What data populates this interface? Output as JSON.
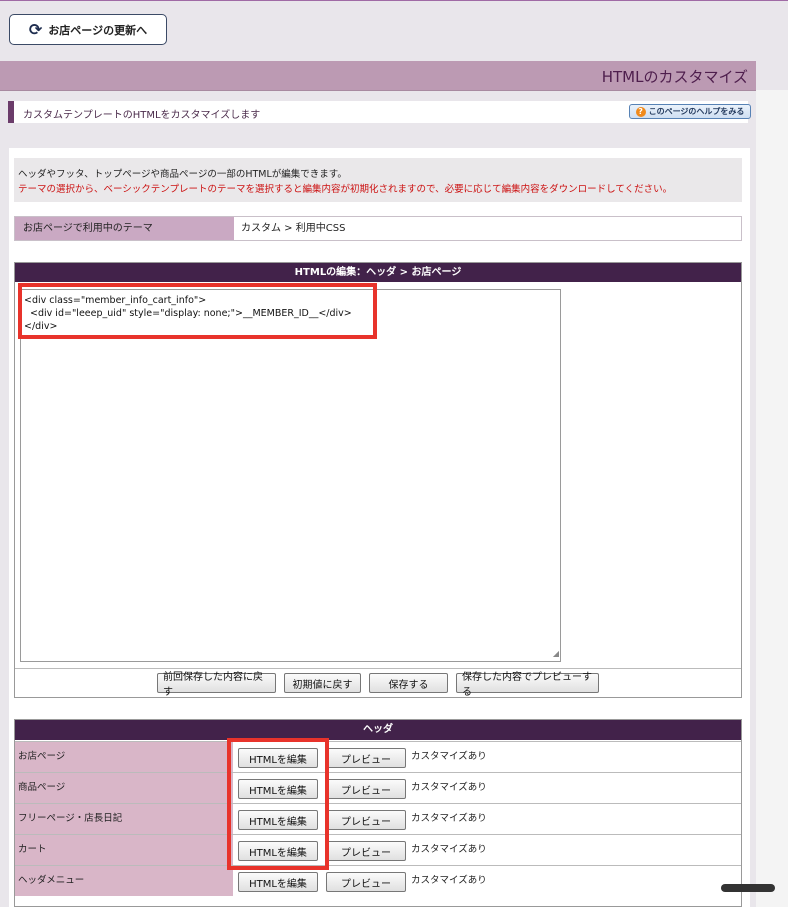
{
  "top_button": {
    "label": "お店ページの更新へ",
    "icon": "refresh-icon"
  },
  "page_title": "HTMLのカスタマイズ",
  "subheader": {
    "text": "カスタムテンプレートのHTMLをカスタマイズします",
    "help_label": "このページのヘルプをみる",
    "help_icon": "question-icon"
  },
  "info": {
    "line1": "ヘッダやフッタ、トップページや商品ページの一部のHTMLが編集できます。",
    "line2": "テーマの選択から、ベーシックテンプレートのテーマを選択すると編集内容が初期化されますので、必要に応じて編集内容をダウンロードしてください。"
  },
  "theme": {
    "label": "お店ページで利用中のテーマ",
    "value": "カスタム > 利用中CSS"
  },
  "editor": {
    "heading": "HTMLの編集：ヘッダ > お店ページ",
    "code_lines": [
      "<div class=\"member_info_cart_info\">",
      "  <div id=\"leeep_uid\" style=\"display: none;\">__MEMBER_ID__</div>",
      "</div>"
    ],
    "buttons": [
      "前回保存した内容に戻す",
      "初期値に戻す",
      "保存する",
      "保存した内容でプレビューする"
    ]
  },
  "header_section": {
    "heading": "ヘッダ",
    "edit_label": "HTMLを編集",
    "preview_label": "プレビュー",
    "rows": [
      {
        "label": "お店ページ",
        "status": "カスタマイズあり"
      },
      {
        "label": "商品ページ",
        "status": "カスタマイズあり"
      },
      {
        "label": "フリーページ・店長日記",
        "status": "カスタマイズあり"
      },
      {
        "label": "カート",
        "status": "カスタマイズあり"
      },
      {
        "label": "ヘッダメニュー",
        "status": "カスタマイズあり"
      }
    ]
  },
  "colors": {
    "accent_dark": "#42224a",
    "title_bar": "#bc9ab3",
    "label_bg": "#d9b6c8",
    "warning_text": "#cc1111",
    "highlight_box": "#e8332b"
  }
}
